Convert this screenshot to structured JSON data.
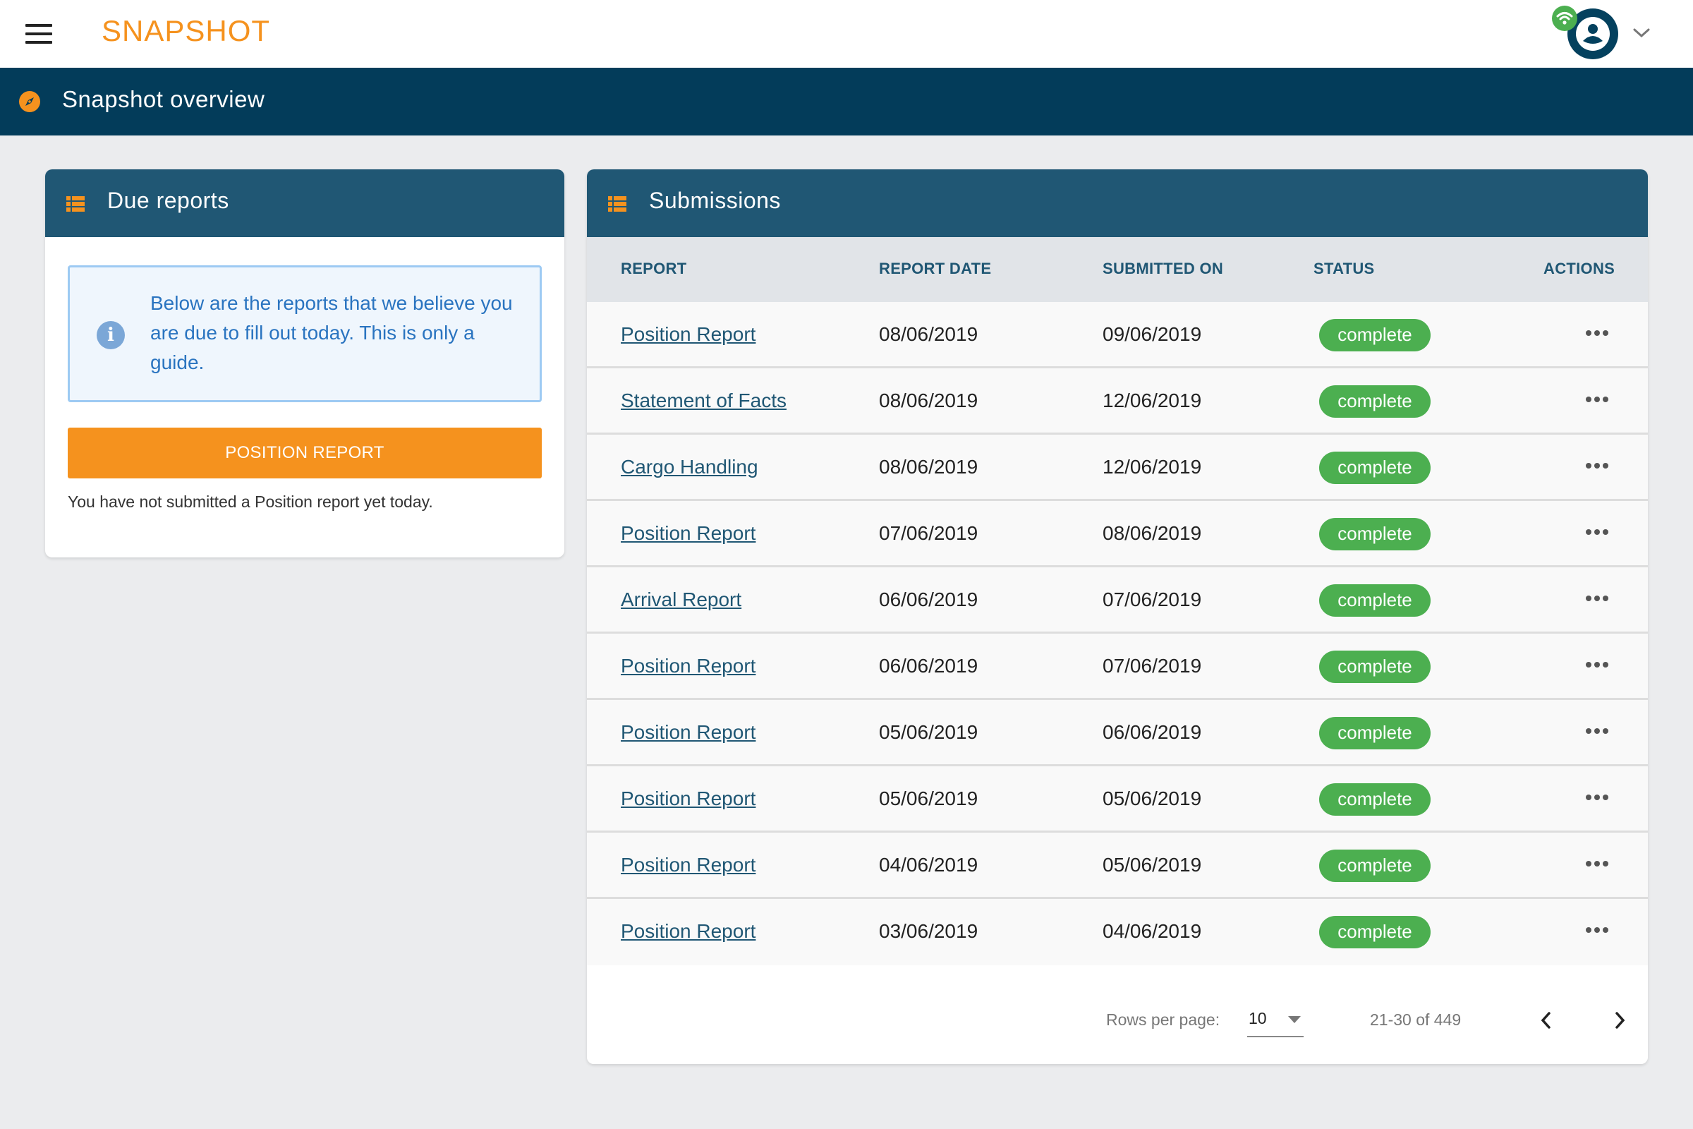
{
  "topbar": {
    "brand": "SNAPSHOT",
    "icons": {
      "menu": "hamburger-menu-icon",
      "avatar": "user-avatar-icon",
      "status": "wifi-icon",
      "dropdown": "chevron-down-icon"
    }
  },
  "navbar": {
    "icon": "compass-icon",
    "title": "Snapshot overview"
  },
  "colors": {
    "brand_orange": "#f5921e",
    "nav_dark": "#033c5a",
    "panel_header": "#205774",
    "status_green": "#4caf50",
    "info_blue": "#2a74c0"
  },
  "due_reports": {
    "title": "Due reports",
    "icon": "list-icon",
    "info_text": "Below are the reports that we believe you are due to fill out today. This is only a guide.",
    "button_label": "POSITION REPORT",
    "note": "You have not submitted a Position report yet today."
  },
  "submissions": {
    "title": "Submissions",
    "icon": "list-icon",
    "columns": [
      "REPORT",
      "REPORT DATE",
      "SUBMITTED ON",
      "STATUS",
      "ACTIONS"
    ],
    "rows": [
      {
        "report": "Position Report",
        "report_date": "08/06/2019",
        "submitted_on": "09/06/2019",
        "status": "complete"
      },
      {
        "report": "Statement of Facts",
        "report_date": "08/06/2019",
        "submitted_on": "12/06/2019",
        "status": "complete"
      },
      {
        "report": "Cargo Handling",
        "report_date": "08/06/2019",
        "submitted_on": "12/06/2019",
        "status": "complete"
      },
      {
        "report": "Position Report",
        "report_date": "07/06/2019",
        "submitted_on": "08/06/2019",
        "status": "complete"
      },
      {
        "report": "Arrival Report",
        "report_date": "06/06/2019",
        "submitted_on": "07/06/2019",
        "status": "complete"
      },
      {
        "report": "Position Report",
        "report_date": "06/06/2019",
        "submitted_on": "07/06/2019",
        "status": "complete"
      },
      {
        "report": "Position Report",
        "report_date": "05/06/2019",
        "submitted_on": "06/06/2019",
        "status": "complete"
      },
      {
        "report": "Position Report",
        "report_date": "05/06/2019",
        "submitted_on": "05/06/2019",
        "status": "complete"
      },
      {
        "report": "Position Report",
        "report_date": "04/06/2019",
        "submitted_on": "05/06/2019",
        "status": "complete"
      },
      {
        "report": "Position Report",
        "report_date": "03/06/2019",
        "submitted_on": "04/06/2019",
        "status": "complete"
      }
    ],
    "pagination": {
      "rows_per_page_label": "Rows per page:",
      "rows_per_page": "10",
      "range": "21-30 of 449"
    }
  }
}
